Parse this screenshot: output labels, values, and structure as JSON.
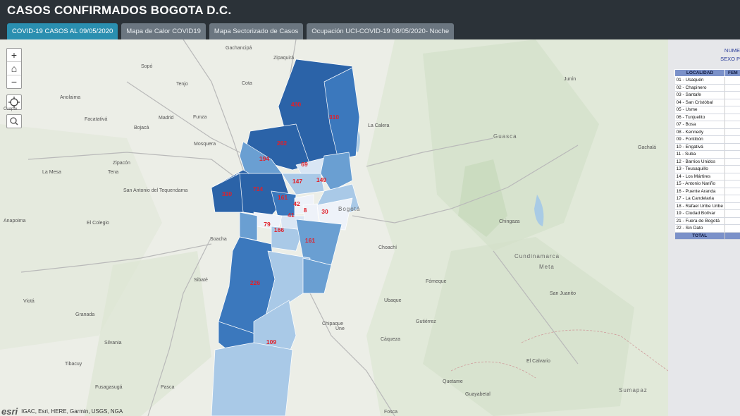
{
  "header": {
    "title": "CASOS CONFIRMADOS BOGOTA D.C."
  },
  "tabs": [
    {
      "label": "COVID-19 CASOS AL 09/05/2020",
      "active": true
    },
    {
      "label": "Mapa de Calor COVID19",
      "active": false
    },
    {
      "label": "Mapa Sectorizado de Casos",
      "active": false
    },
    {
      "label": "Ocupación UCI-COVID-19 08/05/2020- Noche",
      "active": false
    }
  ],
  "map_controls": {
    "zoom_in": "+",
    "home": "⌂",
    "zoom_out": "−",
    "locate_label": "Cuapte",
    "search": "🔍"
  },
  "attribution": {
    "logo": "esri",
    "text": "IGAC, Esri, HERE, Garmin, USGS, NGA"
  },
  "map": {
    "colors": {
      "darkest": "#2b63a8",
      "dark": "#3b78bd",
      "medium": "#6a9fd2",
      "light": "#a9c9e7",
      "lightest": "#d9e6f4",
      "pale": "#eef2f9",
      "label": "#e0202a"
    },
    "case_counts": [
      "430",
      "310",
      "262",
      "194",
      "69",
      "149",
      "147",
      "330",
      "714",
      "161",
      "42",
      "8",
      "30",
      "79",
      "41",
      "166",
      "161",
      "226",
      "109"
    ],
    "places": [
      "Sopó",
      "Gachancipá",
      "Zipaquirá",
      "Cota",
      "Tenjo",
      "Madrid",
      "Funza",
      "Mosquera",
      "Bojacá",
      "Facatativá",
      "Anolaima",
      "Zipacón",
      "La Mesa",
      "Tena",
      "San Antonio del Tequendama",
      "El Colegio",
      "Anapoima",
      "Soacha",
      "Sibaté",
      "Viotá",
      "Granada",
      "Silvania",
      "Tibacuy",
      "Fusagasugá",
      "Pasca",
      "La Calera",
      "Guasca",
      "Choachí",
      "Ubaque",
      "Fómeque",
      "Chipaque",
      "Une",
      "Cáqueza",
      "Fosca",
      "Gutiérrez",
      "Quetame",
      "Guayabetal",
      "Junín",
      "Gachalá",
      "San Juanito",
      "El Calvario",
      "Cundinamarca",
      "Meta",
      "Chingaza",
      "Sumapaz",
      "Bogotá"
    ]
  },
  "panel": {
    "title_line1": "NUME",
    "title_line2": "SEXO P",
    "header_localidad": "LOCALIDAD",
    "header_fem": "FEM",
    "rows": [
      "01 - Usaquén",
      "02 - Chapinero",
      "03 - Santafe",
      "04 - San Cristóbal",
      "05 - Usme",
      "06 - Tunjuelito",
      "07 - Bosa",
      "08 - Kennedy",
      "09 - Fontibón",
      "10 - Engativá",
      "11 - Suba",
      "12 - Barrios Unidos",
      "13 - Teusaquillo",
      "14 - Los Mártires",
      "15 - Antonio Nariño",
      "16 - Puente Aranda",
      "17 - La Candelaria",
      "18 - Rafael Uribe Uribe",
      "19 - Ciudad Bolívar",
      "21 - Fuera de Bogotá",
      "22 - Sin Dato"
    ],
    "total_label": "TOTAL"
  }
}
